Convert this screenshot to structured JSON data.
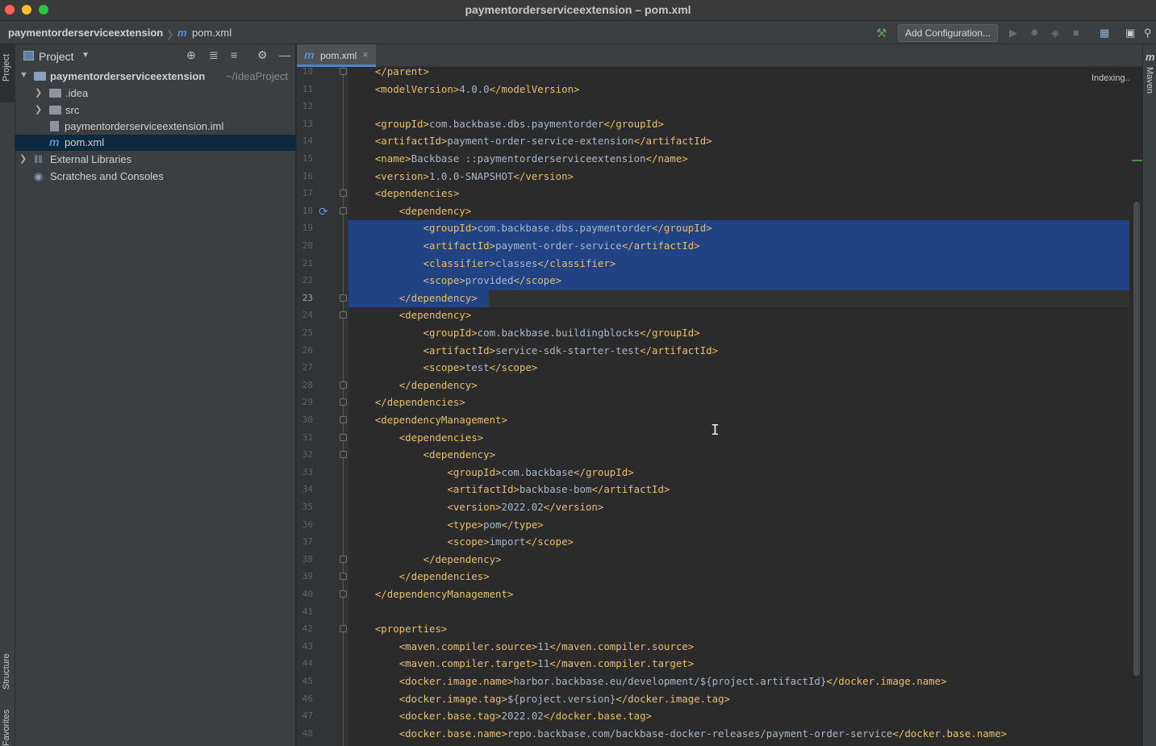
{
  "window": {
    "title": "paymentorderserviceextension – pom.xml"
  },
  "navbar": {
    "breadcrumb_project": "paymentorderserviceextension",
    "breadcrumb_sep": "〉",
    "breadcrumb_file_icon": "m",
    "breadcrumb_file": "pom.xml",
    "add_configuration": "Add Configuration..."
  },
  "toolstrip": {
    "project_tab": "Project",
    "structure_tab": "Structure",
    "favorites_tab": "Favorites",
    "maven_tab": "Maven",
    "maven_icon": "m"
  },
  "project_panel": {
    "title": "Project",
    "tree": [
      {
        "name": "paymentorderserviceextension",
        "suffix": "~/IdeaProject"
      },
      {
        "name": ".idea"
      },
      {
        "name": "src"
      },
      {
        "name": "paymentorderserviceextension.iml"
      },
      {
        "name": "pom.xml",
        "icon": "m"
      },
      {
        "name": "External Libraries"
      },
      {
        "name": "Scratches and Consoles"
      }
    ]
  },
  "editor": {
    "tab_label": "pom.xml",
    "tab_icon": "m",
    "tab_close": "×",
    "indexing_text": "Indexing...",
    "current_line": 23,
    "lines": [
      {
        "n": "10",
        "indent": "    ",
        "parts": [
          [
            "t",
            "</parent>"
          ]
        ]
      },
      {
        "n": "11",
        "indent": "    ",
        "parts": [
          [
            "t",
            "<modelVersion>"
          ],
          [
            "v",
            "4.0.0"
          ],
          [
            "t",
            "</modelVersion>"
          ]
        ]
      },
      {
        "n": "12",
        "indent": "",
        "parts": []
      },
      {
        "n": "13",
        "indent": "    ",
        "parts": [
          [
            "t",
            "<groupId>"
          ],
          [
            "v",
            "com.backbase.dbs.paymentorder"
          ],
          [
            "t",
            "</groupId>"
          ]
        ]
      },
      {
        "n": "14",
        "indent": "    ",
        "parts": [
          [
            "t",
            "<artifactId>"
          ],
          [
            "v",
            "payment-order-service-extension"
          ],
          [
            "t",
            "</artifactId>"
          ]
        ]
      },
      {
        "n": "15",
        "indent": "    ",
        "parts": [
          [
            "t",
            "<name>"
          ],
          [
            "v",
            "Backbase ::paymentorderserviceextension"
          ],
          [
            "t",
            "</name>"
          ]
        ]
      },
      {
        "n": "16",
        "indent": "    ",
        "parts": [
          [
            "t",
            "<version>"
          ],
          [
            "v",
            "1.0.0-SNAPSHOT"
          ],
          [
            "t",
            "</version>"
          ]
        ]
      },
      {
        "n": "17",
        "indent": "    ",
        "parts": [
          [
            "t",
            "<dependencies>"
          ]
        ]
      },
      {
        "n": "18",
        "indent": "        ",
        "parts": [
          [
            "t",
            "<dependency>"
          ]
        ]
      },
      {
        "n": "19",
        "indent": "            ",
        "parts": [
          [
            "t",
            "<groupId>"
          ],
          [
            "v",
            "com.backbase.dbs.paymentorder"
          ],
          [
            "t",
            "</groupId>"
          ]
        ]
      },
      {
        "n": "20",
        "indent": "            ",
        "parts": [
          [
            "t",
            "<artifactId>"
          ],
          [
            "v",
            "payment-order-service"
          ],
          [
            "t",
            "</artifactId>"
          ]
        ]
      },
      {
        "n": "21",
        "indent": "            ",
        "parts": [
          [
            "t",
            "<classifier>"
          ],
          [
            "v",
            "classes"
          ],
          [
            "t",
            "</classifier>"
          ]
        ]
      },
      {
        "n": "22",
        "indent": "            ",
        "parts": [
          [
            "t",
            "<scope>"
          ],
          [
            "v",
            "provided"
          ],
          [
            "t",
            "</scope>"
          ]
        ]
      },
      {
        "n": "23",
        "indent": "        ",
        "parts": [
          [
            "t",
            "</dependency>"
          ]
        ]
      },
      {
        "n": "24",
        "indent": "        ",
        "parts": [
          [
            "t",
            "<dependency>"
          ]
        ]
      },
      {
        "n": "25",
        "indent": "            ",
        "parts": [
          [
            "t",
            "<groupId>"
          ],
          [
            "v",
            "com.backbase.buildingblocks"
          ],
          [
            "t",
            "</groupId>"
          ]
        ]
      },
      {
        "n": "26",
        "indent": "            ",
        "parts": [
          [
            "t",
            "<artifactId>"
          ],
          [
            "v",
            "service-sdk-starter-test"
          ],
          [
            "t",
            "</artifactId>"
          ]
        ]
      },
      {
        "n": "27",
        "indent": "            ",
        "parts": [
          [
            "t",
            "<scope>"
          ],
          [
            "v",
            "test"
          ],
          [
            "t",
            "</scope>"
          ]
        ]
      },
      {
        "n": "28",
        "indent": "        ",
        "parts": [
          [
            "t",
            "</dependency>"
          ]
        ]
      },
      {
        "n": "29",
        "indent": "    ",
        "parts": [
          [
            "t",
            "</dependencies>"
          ]
        ]
      },
      {
        "n": "30",
        "indent": "    ",
        "parts": [
          [
            "t",
            "<dependencyManagement>"
          ]
        ]
      },
      {
        "n": "31",
        "indent": "        ",
        "parts": [
          [
            "t",
            "<dependencies>"
          ]
        ]
      },
      {
        "n": "32",
        "indent": "            ",
        "parts": [
          [
            "t",
            "<dependency>"
          ]
        ]
      },
      {
        "n": "33",
        "indent": "                ",
        "parts": [
          [
            "t",
            "<groupId>"
          ],
          [
            "v",
            "com.backbase"
          ],
          [
            "t",
            "</groupId>"
          ]
        ]
      },
      {
        "n": "34",
        "indent": "                ",
        "parts": [
          [
            "t",
            "<artifactId>"
          ],
          [
            "v",
            "backbase-bom"
          ],
          [
            "t",
            "</artifactId>"
          ]
        ]
      },
      {
        "n": "35",
        "indent": "                ",
        "parts": [
          [
            "t",
            "<version>"
          ],
          [
            "v",
            "2022.02"
          ],
          [
            "t",
            "</version>"
          ]
        ]
      },
      {
        "n": "36",
        "indent": "                ",
        "parts": [
          [
            "t",
            "<type>"
          ],
          [
            "v",
            "pom"
          ],
          [
            "t",
            "</type>"
          ]
        ]
      },
      {
        "n": "37",
        "indent": "                ",
        "parts": [
          [
            "t",
            "<scope>"
          ],
          [
            "v",
            "import"
          ],
          [
            "t",
            "</scope>"
          ]
        ]
      },
      {
        "n": "38",
        "indent": "            ",
        "parts": [
          [
            "t",
            "</dependency>"
          ]
        ]
      },
      {
        "n": "39",
        "indent": "        ",
        "parts": [
          [
            "t",
            "</dependencies>"
          ]
        ]
      },
      {
        "n": "40",
        "indent": "    ",
        "parts": [
          [
            "t",
            "</dependencyManagement>"
          ]
        ]
      },
      {
        "n": "41",
        "indent": "",
        "parts": []
      },
      {
        "n": "42",
        "indent": "    ",
        "parts": [
          [
            "t",
            "<properties>"
          ]
        ]
      },
      {
        "n": "43",
        "indent": "        ",
        "parts": [
          [
            "t",
            "<maven.compiler.source>"
          ],
          [
            "v",
            "11"
          ],
          [
            "t",
            "</maven.compiler.source>"
          ]
        ]
      },
      {
        "n": "44",
        "indent": "        ",
        "parts": [
          [
            "t",
            "<maven.compiler.target>"
          ],
          [
            "v",
            "11"
          ],
          [
            "t",
            "</maven.compiler.target>"
          ]
        ]
      },
      {
        "n": "45",
        "indent": "        ",
        "parts": [
          [
            "t",
            "<docker.image.name>"
          ],
          [
            "v",
            "harbor.backbase.eu/development/${project.artifactId}"
          ],
          [
            "t",
            "</docker.image.name>"
          ]
        ]
      },
      {
        "n": "46",
        "indent": "        ",
        "parts": [
          [
            "t",
            "<docker.image.tag>"
          ],
          [
            "v",
            "${project.version}"
          ],
          [
            "t",
            "</docker.image.tag>"
          ]
        ]
      },
      {
        "n": "47",
        "indent": "        ",
        "parts": [
          [
            "t",
            "<docker.base.tag>"
          ],
          [
            "v",
            "2022.02"
          ],
          [
            "t",
            "</docker.base.tag>"
          ]
        ]
      },
      {
        "n": "48",
        "indent": "        ",
        "parts": [
          [
            "t",
            "<docker.base.name>"
          ],
          [
            "v",
            "repo.backbase.com/backbase-docker-releases/payment-order-service"
          ],
          [
            "t",
            "</docker.base.name>"
          ]
        ]
      }
    ]
  },
  "colors": {
    "tag": "#e8bf6a",
    "text": "#a9b7c6",
    "selection": "#214283",
    "accent": "#4a88c7"
  },
  "icons": {
    "hammer": "hammer-icon",
    "run": "run-icon",
    "debug": "debug-icon",
    "coverage": "coverage-icon",
    "stop": "stop-icon",
    "project_structure": "project-structure-icon",
    "layout": "layout-icon",
    "search": "search-icon",
    "locate": "locate-icon",
    "expand_all": "expand-all-icon",
    "collapse_all": "collapse-all-icon",
    "gear": "gear-icon",
    "hide": "minimize-icon",
    "gutter_override": "implemented-icon"
  }
}
